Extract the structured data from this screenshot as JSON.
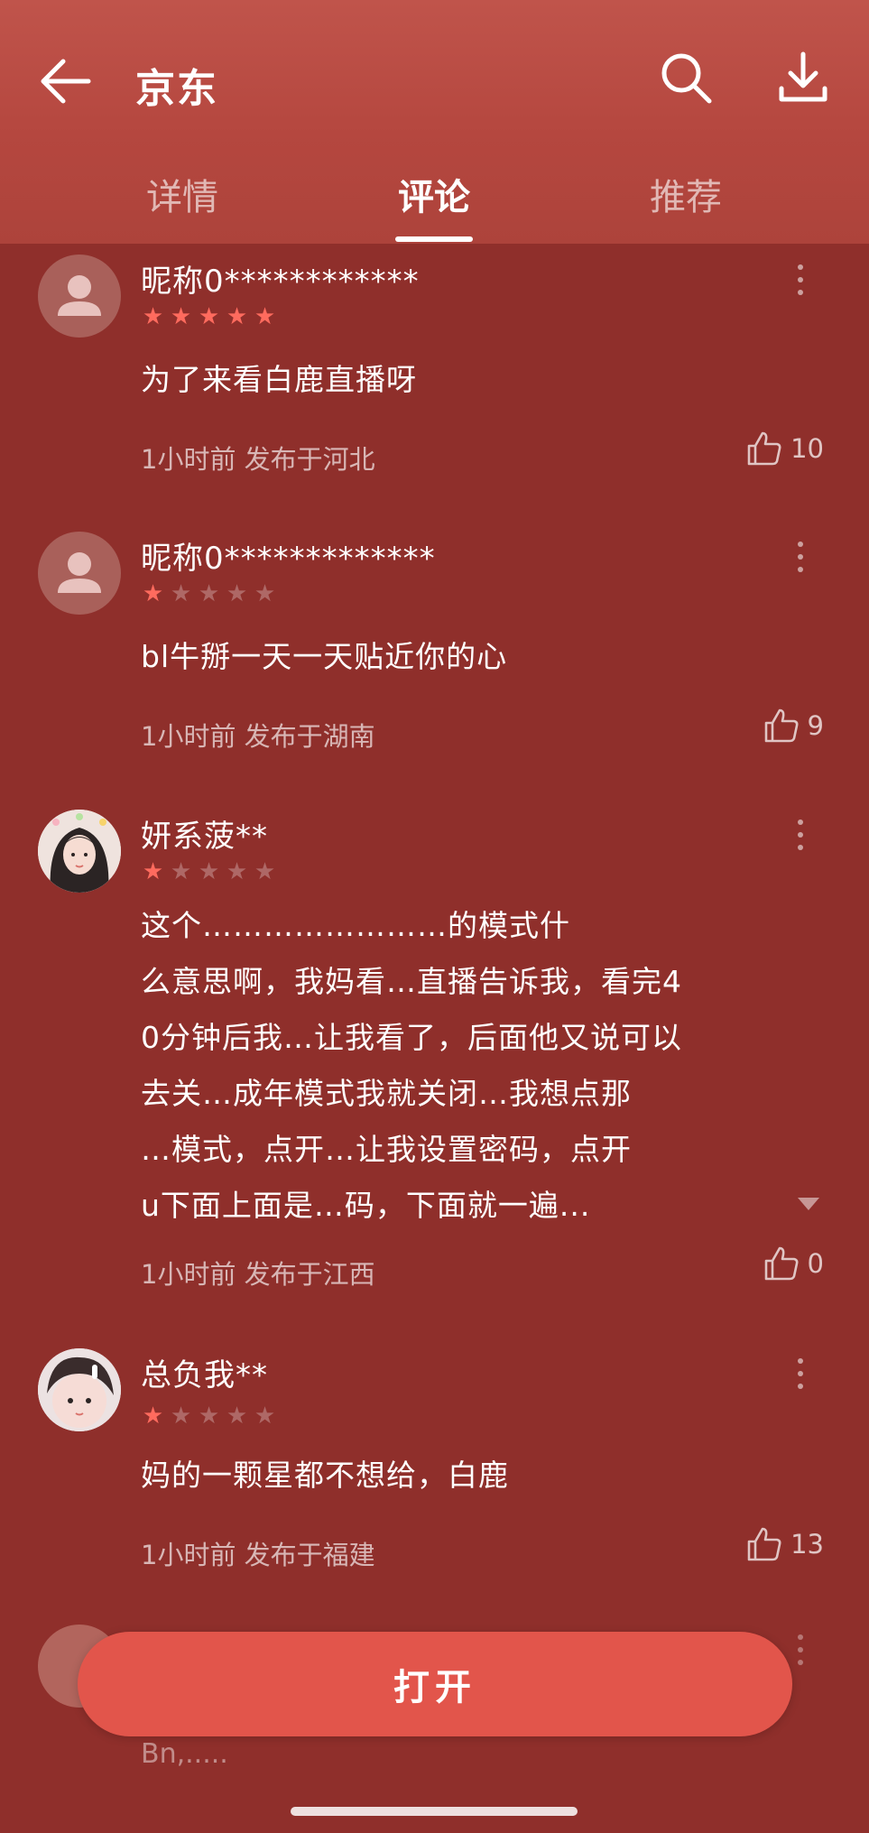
{
  "header": {
    "title": "京东",
    "tabs": [
      {
        "label": "详情",
        "active": false
      },
      {
        "label": "评论",
        "active": true
      },
      {
        "label": "推荐",
        "active": false
      }
    ]
  },
  "comments": [
    {
      "nickname": "昵称0************",
      "stars": 5,
      "text": "为了来看白鹿直播呀",
      "meta": "1小时前 发布于河北",
      "likes": "10",
      "avatar": "default-avatar"
    },
    {
      "nickname": "昵称0*************",
      "stars": 1,
      "text": "bl牛掰一天一天贴近你的心",
      "meta": "1小时前 发布于湖南",
      "likes": "9",
      "avatar": "default-avatar"
    },
    {
      "nickname": "妍系菠**",
      "stars": 1,
      "text_lines": [
        "这个……………………的模式什",
        "么意思啊，我妈看…直播告诉我，看完4",
        "0分钟后我…让我看了，后面他又说可以",
        "去关…成年模式我就关闭…我想点那",
        "…模式，点开…让我设置密码，点开",
        "u下面上面是…码，下面就一遍..."
      ],
      "meta": "1小时前 发布于江西",
      "likes": "0",
      "avatar": "photo-avatar"
    },
    {
      "nickname": "总负我**",
      "stars": 1,
      "text": "妈的一颗星都不想给，白鹿",
      "meta": "1小时前 发布于福建",
      "likes": "13",
      "avatar": "photo-avatar"
    }
  ],
  "open_button": {
    "label": "打开"
  },
  "trailing_text": "Bn,.....",
  "colors": {
    "background": "#8f2f2b",
    "header": "#b5473f",
    "star_on": "#ff6b5e",
    "button": "#e2554b"
  }
}
